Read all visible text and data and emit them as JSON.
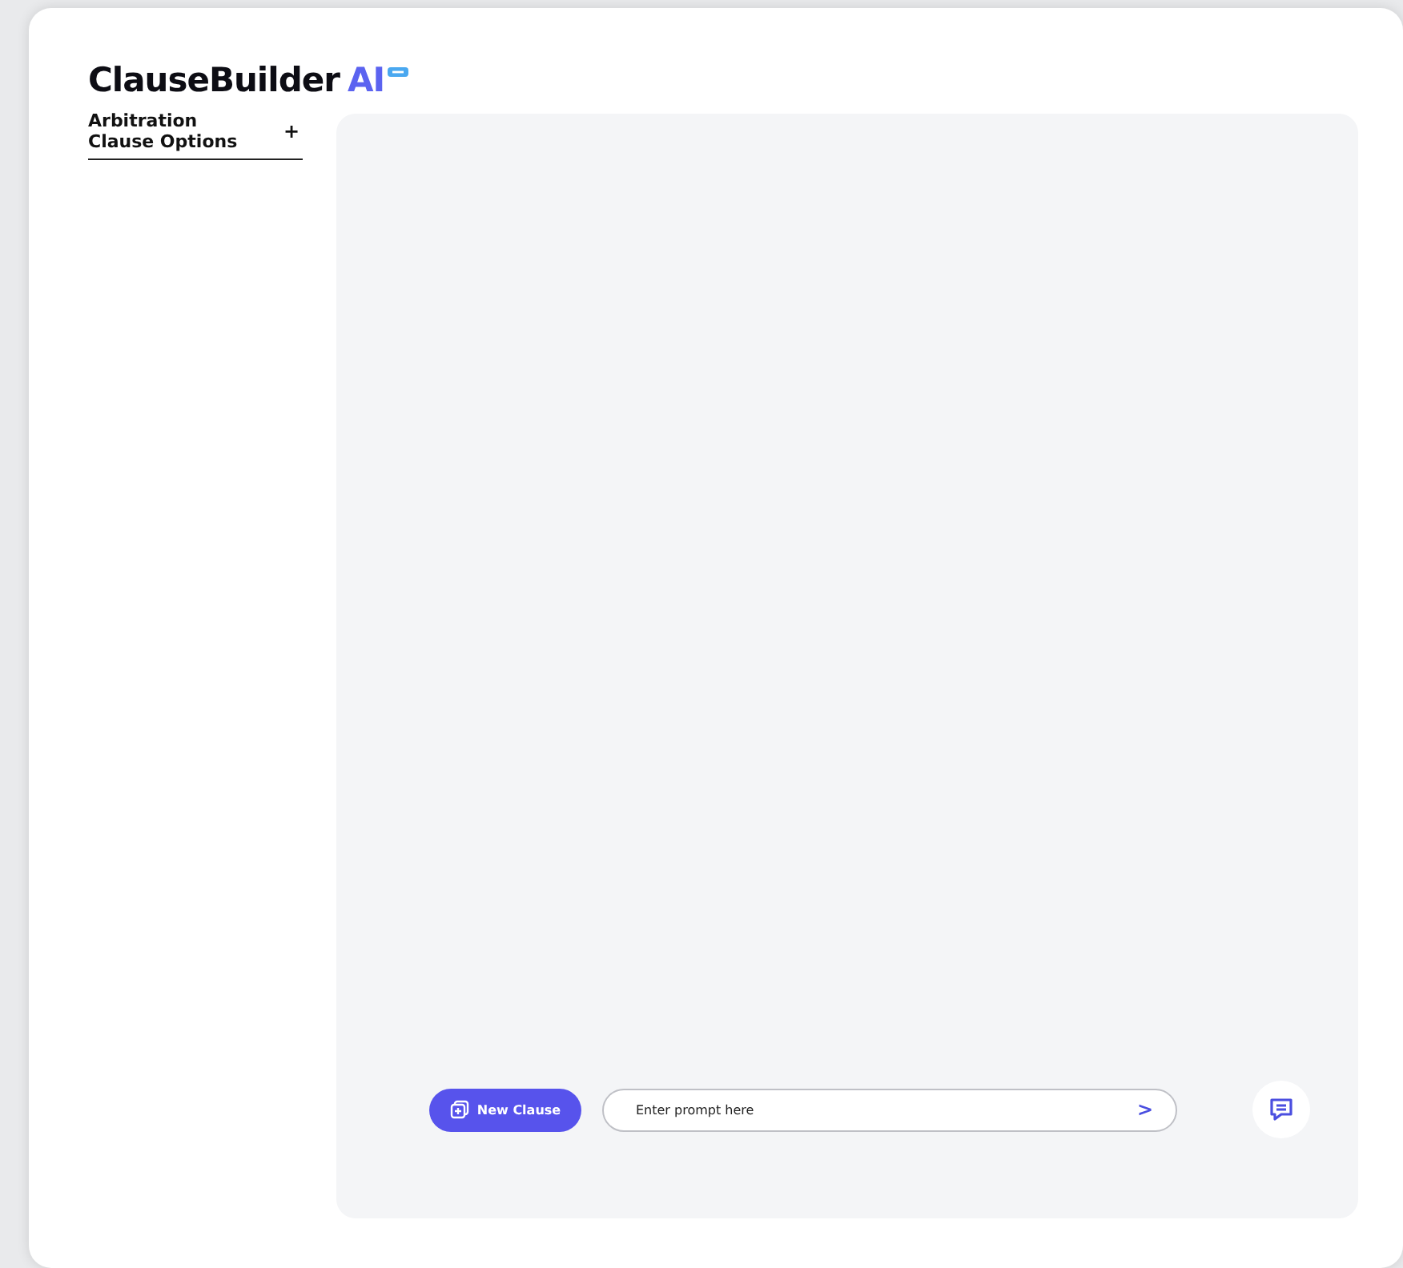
{
  "logo": {
    "name": "ClauseBuilder",
    "suffix": "AI"
  },
  "sidebar": {
    "items": [
      {
        "label": "Arbitration Clause Options",
        "action": "+"
      }
    ]
  },
  "composer": {
    "new_button": "New Clause",
    "prompt": {
      "placeholder": "Enter prompt here"
    },
    "send": ">"
  }
}
